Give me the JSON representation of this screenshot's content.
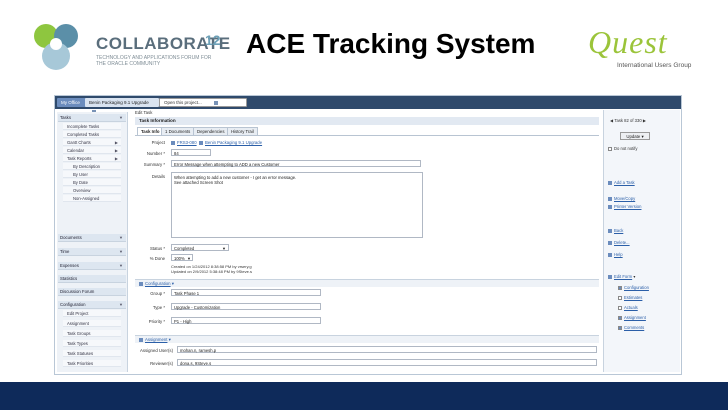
{
  "slide": {
    "title": "ACE Tracking System",
    "collaborate_word": "COLLABORATE",
    "collaborate_year": "12",
    "collaborate_sub": "TECHNOLOGY AND APPLICATIONS FORUM FOR THE ORACLE COMMUNITY",
    "quest_word": "Quest",
    "quest_sub": "International Users Group"
  },
  "topbar": {
    "tab_myoffice": "My Office",
    "tab_project": "Benin Packaging 9.1 Upgrade",
    "open_project_placeholder": "Open this project..."
  },
  "left_panel": {
    "tasks": {
      "title": "Tasks",
      "items": [
        "Incomplete Tasks",
        "Completed Tasks",
        "Gantt Charts",
        "Calendar",
        "Task Reports",
        "By Description",
        "By User",
        "By Date",
        "Overview",
        "Non-Assigned"
      ]
    },
    "sections": [
      "Documents",
      "Time",
      "Expenses",
      "Statistics",
      "Discussion Forum",
      "Configuration"
    ],
    "config_items": [
      "Edit Project",
      "Assignment",
      "Task Groups",
      "Task Types",
      "Task Statuses",
      "Task Priorities"
    ]
  },
  "main": {
    "panel_title": "Edit Task",
    "panel_head": "Task Information",
    "tabs": [
      "Task Info",
      "1 Documents",
      "Dependencies",
      "History Trail"
    ],
    "fields": {
      "project_label": "Project",
      "project_code": "FRS3-080",
      "project_name": "Benin Packaging 9.1 Upgrade",
      "number_label": "Number *",
      "number_value": "84",
      "summary_label": "Summary *",
      "summary_value": "Error Message when attempting to ADD a new Customer",
      "details_label": "Details",
      "details_line1": "When attempting to add a new customer - I get an error message.",
      "details_line2": "See attached Screen Shot",
      "status_label": "Status *",
      "status_value": "Completed",
      "done_label": "% Done",
      "done_value": "100%",
      "created_text": "Created on 1/24/2012 8:38:58 PM by vrsery.g",
      "updated_text": "Updated on 2/9/2012 5:38:48 PM by 9Steve.s"
    },
    "configuration": {
      "bar_label": "Configuration",
      "group_label": "Group *",
      "group_value": "Task Phase 1",
      "type_label": "Type *",
      "type_value": "Upgrade - Customization",
      "priority_label": "Priority *",
      "priority_value": "P1 - High"
    },
    "assignment": {
      "bar_label": "Assignment",
      "assigned_label": "Assigned User(s)",
      "assigned_value": "mohan.n, ramesh.p",
      "reviewer_label": "Reviewer(s)",
      "reviewer_value": "dona.s, 9Steve.s"
    }
  },
  "right_panel": {
    "task_counter": "Task 82 of 330",
    "update_button": "Update",
    "do_not_notify": "Do not notify",
    "actions": [
      "Add a Task",
      "Move/Copy",
      "Printer Version",
      "Back",
      "Delete...",
      "Help"
    ],
    "edit_form_label": "Edit Form",
    "form_items": [
      {
        "label": "Configuration",
        "checked": true
      },
      {
        "label": "Estimates",
        "checked": false
      },
      {
        "label": "Actuals",
        "checked": false
      },
      {
        "label": "Assignment",
        "checked": true
      },
      {
        "label": "Comments",
        "checked": true
      }
    ]
  }
}
